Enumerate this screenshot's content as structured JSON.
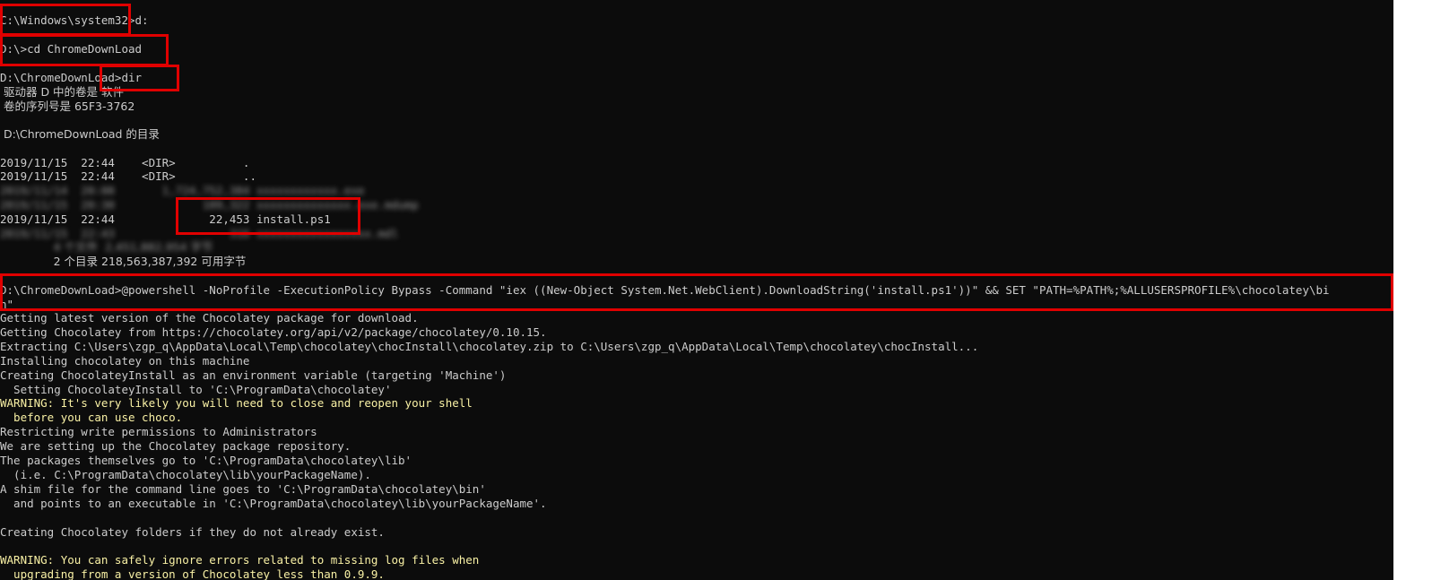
{
  "console": {
    "prompt_lines": {
      "system32_cmd": "C:\\Windows\\system32>d:",
      "cd_cmd": "D:\\>cd ChromeDownLoad",
      "dir_cmd": "D:\\ChromeDownLoad>dir"
    },
    "dir_output": {
      "volume_label": " 驱动器 D 中的卷是 软件",
      "serial": " 卷的序列号是 65F3-3762",
      "directory_of": " D:\\ChromeDownLoad 的目录",
      "entry_dot": "2019/11/15  22:44    <DIR>          .",
      "entry_dotdot": "2019/11/15  22:44    <DIR>          ..",
      "blurred_1": "2019/11/14  20:08       1,724,752,384 xxxxxxxxxxxx.exe",
      "blurred_2": "2019/11/15  20:30             109,322 xxxxxxxxxxxxxx.exe.mdump",
      "entry_install": "2019/11/15  22:44              22,453 install.ps1",
      "blurred_3": "2019/11/15  22:43                 316 xxxxxxxxxxxxxxxxx.mdl",
      "file_count": "               4 个文件  2,451,882,954 字节",
      "dir_count": "               2 个目录 218,563,387,392 可用字节"
    },
    "powershell_cmd": "D:\\ChromeDownLoad>@powershell -NoProfile -ExecutionPolicy Bypass -Command \"iex ((New-Object System.Net.WebClient).DownloadString('install.ps1'))\" && SET \"PATH=%PATH%;%ALLUSERSPROFILE%\\chocolatey\\bi",
    "powershell_cmd_wrap": "n\"",
    "output_lines": [
      {
        "text": "Getting latest version of the Chocolatey package for download.",
        "warn": false
      },
      {
        "text": "Getting Chocolatey from https://chocolatey.org/api/v2/package/chocolatey/0.10.15.",
        "warn": false
      },
      {
        "text": "Extracting C:\\Users\\zgp_q\\AppData\\Local\\Temp\\chocolatey\\chocInstall\\chocolatey.zip to C:\\Users\\zgp_q\\AppData\\Local\\Temp\\chocolatey\\chocInstall...",
        "warn": false
      },
      {
        "text": "Installing chocolatey on this machine",
        "warn": false
      },
      {
        "text": "Creating ChocolateyInstall as an environment variable (targeting 'Machine')",
        "warn": false
      },
      {
        "text": "  Setting ChocolateyInstall to 'C:\\ProgramData\\chocolatey'",
        "warn": false
      },
      {
        "text": "WARNING: It's very likely you will need to close and reopen your shell",
        "warn": true
      },
      {
        "text": "  before you can use choco.",
        "warn": true
      },
      {
        "text": "Restricting write permissions to Administrators",
        "warn": false
      },
      {
        "text": "We are setting up the Chocolatey package repository.",
        "warn": false
      },
      {
        "text": "The packages themselves go to 'C:\\ProgramData\\chocolatey\\lib'",
        "warn": false
      },
      {
        "text": "  (i.e. C:\\ProgramData\\chocolatey\\lib\\yourPackageName).",
        "warn": false
      },
      {
        "text": "A shim file for the command line goes to 'C:\\ProgramData\\chocolatey\\bin'",
        "warn": false
      },
      {
        "text": "  and points to an executable in 'C:\\ProgramData\\chocolatey\\lib\\yourPackageName'.",
        "warn": false
      },
      {
        "text": "",
        "warn": false
      },
      {
        "text": "Creating Chocolatey folders if they do not already exist.",
        "warn": false
      },
      {
        "text": "",
        "warn": false
      },
      {
        "text": "WARNING: You can safely ignore errors related to missing log files when",
        "warn": true
      },
      {
        "text": "  upgrading from a version of Chocolatey less than 0.9.9.",
        "warn": true
      }
    ]
  },
  "colors": {
    "background": "#0c0c0c",
    "text": "#cccccc",
    "warning": "#f9f1a5",
    "highlight_box": "#e00000"
  }
}
